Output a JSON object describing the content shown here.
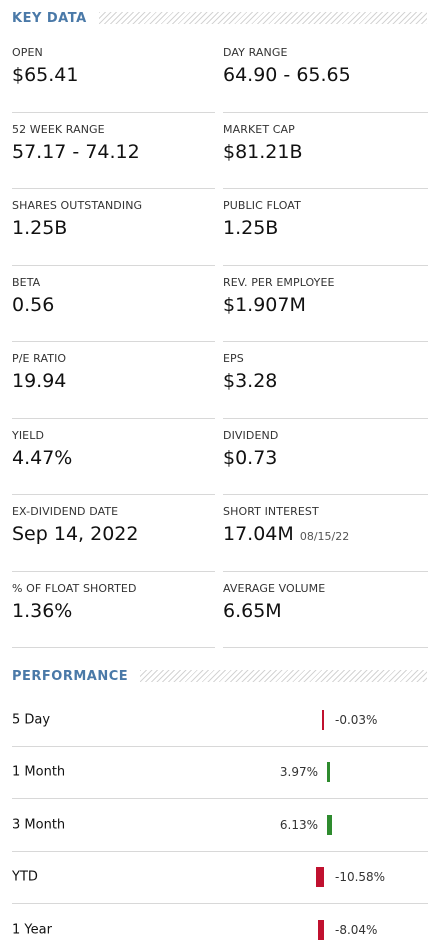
{
  "key_data": {
    "title": "KEY DATA",
    "rows": [
      [
        {
          "label": "OPEN",
          "value": "$65.41",
          "sub": ""
        },
        {
          "label": "DAY RANGE",
          "value": "64.90 - 65.65",
          "sub": ""
        }
      ],
      [
        {
          "label": "52 WEEK RANGE",
          "value": "57.17 - 74.12",
          "sub": ""
        },
        {
          "label": "MARKET CAP",
          "value": "$81.21B",
          "sub": ""
        }
      ],
      [
        {
          "label": "SHARES OUTSTANDING",
          "value": "1.25B",
          "sub": ""
        },
        {
          "label": "PUBLIC FLOAT",
          "value": "1.25B",
          "sub": ""
        }
      ],
      [
        {
          "label": "BETA",
          "value": "0.56",
          "sub": ""
        },
        {
          "label": "REV. PER EMPLOYEE",
          "value": "$1.907M",
          "sub": ""
        }
      ],
      [
        {
          "label": "P/E RATIO",
          "value": "19.94",
          "sub": ""
        },
        {
          "label": "EPS",
          "value": "$3.28",
          "sub": ""
        }
      ],
      [
        {
          "label": "YIELD",
          "value": "4.47%",
          "sub": ""
        },
        {
          "label": "DIVIDEND",
          "value": "$0.73",
          "sub": ""
        }
      ],
      [
        {
          "label": "EX-DIVIDEND DATE",
          "value": "Sep 14, 2022",
          "sub": ""
        },
        {
          "label": "SHORT INTEREST",
          "value": "17.04M",
          "sub": "08/15/22"
        }
      ],
      [
        {
          "label": "% OF FLOAT SHORTED",
          "value": "1.36%",
          "sub": ""
        },
        {
          "label": "AVERAGE VOLUME",
          "value": "6.65M",
          "sub": ""
        }
      ]
    ]
  },
  "performance": {
    "title": "PERFORMANCE",
    "colors": {
      "positive": "#2e8b2e",
      "negative": "#c0112f"
    },
    "rows": [
      {
        "period": "5 Day",
        "change_pct": -0.03,
        "display": "-0.03%"
      },
      {
        "period": "1 Month",
        "change_pct": 3.97,
        "display": "3.97%"
      },
      {
        "period": "3 Month",
        "change_pct": 6.13,
        "display": "6.13%"
      },
      {
        "period": "YTD",
        "change_pct": -10.58,
        "display": "-10.58%"
      },
      {
        "period": "1 Year",
        "change_pct": -8.04,
        "display": "-8.04%"
      }
    ]
  }
}
